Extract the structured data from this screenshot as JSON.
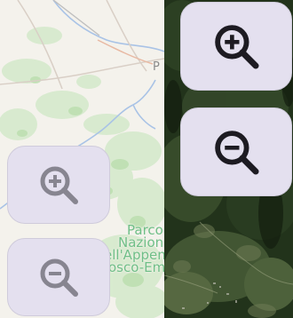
{
  "map_street": {
    "place_label": "P",
    "park_label_lines": [
      "Parco",
      "Nazionale",
      "ell'Appen",
      "osco-Em"
    ]
  },
  "controls": {
    "street_zoom_in": {
      "icon": "zoom-in-icon",
      "color": "#878590"
    },
    "street_zoom_out": {
      "icon": "zoom-out-icon",
      "color": "#878590"
    },
    "satellite_zoom_in": {
      "icon": "zoom-in-icon",
      "color": "#1d1b22"
    },
    "satellite_zoom_out": {
      "icon": "zoom-out-icon",
      "color": "#1d1b22"
    }
  },
  "colors": {
    "button_bg": "#e4e0ef",
    "park_green": "#6fbf87",
    "street_bg": "#f4f2ec",
    "satellite_bg": "#1c2a16"
  }
}
